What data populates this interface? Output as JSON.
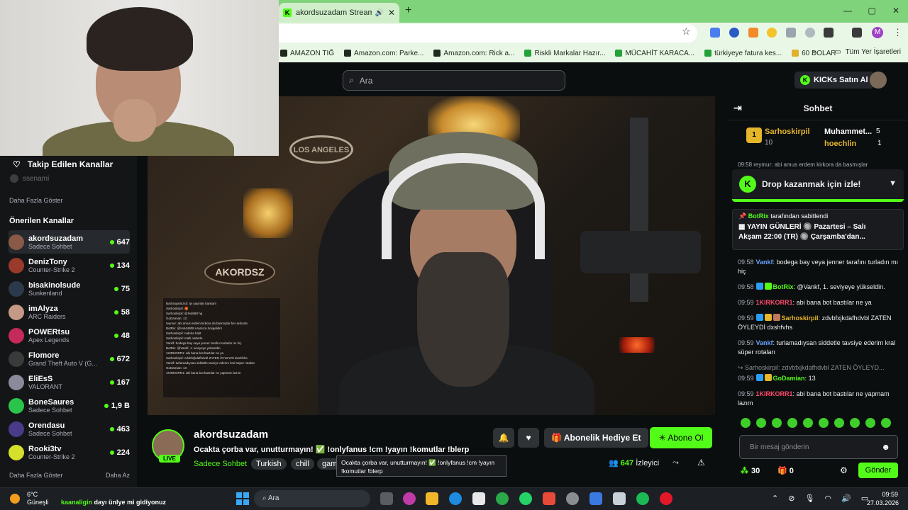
{
  "browser": {
    "tab_title": "akordsuzadam Stream - W...",
    "tab_close": "✕",
    "new_tab": "+",
    "window_controls": [
      "—",
      "▢",
      "✕"
    ],
    "profile_initial": "M",
    "bookmarks": [
      {
        "label": "AMAZON TIĞ",
        "color": "#1e2a1e"
      },
      {
        "label": "Amazon.com: Parke...",
        "color": "#1e2a1e"
      },
      {
        "label": "Amazon.com: Rick a...",
        "color": "#1e2a1e"
      },
      {
        "label": "Riskli Markalar Hazır...",
        "color": "#23a23a"
      },
      {
        "label": "MÜCAHİT KARACA...",
        "color": "#23a23a"
      },
      {
        "label": "türkiyeye fatura kes...",
        "color": "#23a23a"
      },
      {
        "label": "60 DOLAR",
        "color": "#e2b12c"
      }
    ],
    "bookmarks_overflow": "»",
    "all_bookmarks": "Tüm Yer İşaretleri"
  },
  "header": {
    "search_placeholder": "Ara",
    "kicks_button": "KICKs Satın Al"
  },
  "sidebar": {
    "followed_title": "Takip Edilen Kanallar",
    "followed_channel": "ssenami",
    "show_more": "Daha Fazla Göster",
    "suggested_title": "Önerilen Kanallar",
    "channels": [
      {
        "name": "akordsuzadam",
        "game": "Sadece Sohbet",
        "viewers": "647",
        "avatar": "#8a5a48"
      },
      {
        "name": "DenizTony",
        "game": "Counter-Strike 2",
        "viewers": "134",
        "avatar": "#9a3a2a"
      },
      {
        "name": "bisakinolsude",
        "game": "Sunkenland",
        "viewers": "75",
        "avatar": "#2a3a4a"
      },
      {
        "name": "imAlyza",
        "game": "ARC Raiders",
        "viewers": "58",
        "avatar": "#c49a86"
      },
      {
        "name": "POWERtsu",
        "game": "Apex Legends",
        "viewers": "48",
        "avatar": "#c42a5a"
      },
      {
        "name": "Flomore",
        "game": "Grand Theft Auto V (G...",
        "viewers": "672",
        "avatar": "#3a3a3a"
      },
      {
        "name": "EliEsS",
        "game": "VALORANT",
        "viewers": "167",
        "avatar": "#8a8a9a"
      },
      {
        "name": "BoneSaures",
        "game": "Sadece Sohbet",
        "viewers": "1,9 B",
        "avatar": "#2ac44a"
      },
      {
        "name": "Orendasu",
        "game": "Sadece Sohbet",
        "viewers": "463",
        "avatar": "#4a3a8a"
      },
      {
        "name": "Rooki3tv",
        "game": "Counter-Strike 2",
        "viewers": "224",
        "avatar": "#d4e02a"
      }
    ],
    "footer_more": "Daha Fazla Göster",
    "footer_less": "Daha Az"
  },
  "video": {
    "sign_top": "LOS ANGELES",
    "sign_lower": "AKORDSZ",
    "overlay_lines": [
      "lambrayamizx0: iyi yayınlar kankam",
      "Sarhoskirpil: 🎁",
      "Sarhoskirpil: @Hol668 hg",
      "GoDamian: 13",
      "reymur: abi amus erdem kirkora da basmışlar ber ardında",
      "BotRix: @Hol44808 Aramıza hosgeldin!",
      "Sarhoskirpil: nabırla halit",
      "Sarhoskirpil: malli neberle",
      "Vankf: bodega bay veya jenner tarafını turladın mı hiç",
      "BotRix: @Vankf, 1. seviyeye yükseldin.",
      "1KIRKORR1: abi bana bot bastılar ne ya",
      "Sarhoskirpil: zdvbfxjkdafhdvbl ZATEN ÖYLEYDİ dxshfvhs",
      "Vankf: turlamadıysan siddetle tavsiye ederim kral süper rotaları",
      "GoDamian: 13",
      "1KIRKORR1: abi bana bot bastılar ne yapmam lazım"
    ]
  },
  "stream": {
    "channel_name": "akordsuzadam",
    "live_badge": "LIVE",
    "title": "Ocakta çorba var, unutturmayın! ✅ !onlyfanus !cm !yayın  !komutlar !blerp",
    "category": "Sadece Sohbet",
    "tags": [
      "Turkish",
      "chill",
      "gam"
    ],
    "gift_button": "Abonelik Hediye Et",
    "subscribe_button": "Abone Ol",
    "viewer_count": "647",
    "viewer_label": "İzleyici",
    "tooltip": "Ocakta çorba var, unutturmayın! ✅ !onlyfanus !cm !yayın !komutlar !blerp"
  },
  "chat": {
    "title": "Sohbet",
    "leaderboard": [
      {
        "rank": "1",
        "name": "Sarhoskirpil",
        "value": "10",
        "color": "#e5b52a"
      },
      {
        "name": "Muhammet...",
        "value": "5",
        "color": "#ffffff"
      },
      {
        "name": "hoechlin",
        "value": "1",
        "color": "#e5b52a"
      }
    ],
    "scrolled_message": "09:58 reymur: abi amus erdem kirkora da basmışlar",
    "drop_banner": "Drop kazanmak için izle!",
    "pinned_by_name": "BotRix",
    "pinned_by_suffix": "tarafından sabitlendi",
    "pinned_text_1": "▦ YAYIN GÜNLERİ 🔘 Pazartesi – Salı",
    "pinned_text_2": "Akşam 22:00 (TR) 🔘 Çarşamba'dan...",
    "messages": [
      {
        "time": "09:58",
        "user": "Vankf",
        "color": "#66a3ff",
        "badges": [],
        "text": "bodega bay veya jenner tarafını turladın mı hiç"
      },
      {
        "time": "09:58",
        "user": "BotRix",
        "color": "#53fc18",
        "badges": [
          "#2a9df4",
          "#53fc18"
        ],
        "text": "@Vankf, 1. seviyeye yükseldin."
      },
      {
        "time": "09:59",
        "user": "1KIRKORR1",
        "color": "#ff4a6a",
        "badges": [],
        "text": "abi bana bot bastılar ne ya"
      },
      {
        "time": "09:59",
        "user": "Sarhoskirpil",
        "color": "#e5b52a",
        "badges": [
          "#2a9df4",
          "#e5b52a",
          "#c07a5a"
        ],
        "text": "zdvbfxjkdafhdvbl ZATEN ÖYLEYDİ dxshfvhs"
      },
      {
        "time": "09:59",
        "user": "Vankf",
        "color": "#66a3ff",
        "badges": [],
        "text": "turlamadıysan siddetle tavsiye ederim kral süper rotaları"
      },
      {
        "time": "09:59",
        "user": "GoDamian",
        "color": "#53fc18",
        "badges": [
          "#2a9df4",
          "#e5b52a"
        ],
        "text": "13",
        "reply": "↪ Sarhoskirpil: zdvbfxjkdafhdvbl ZATEN ÖYLEYD..."
      },
      {
        "time": "09:59",
        "user": "1KIRKORR1",
        "color": "#ff4a6a",
        "badges": [],
        "text": "abi bana bot bastılar ne yapmam lazım"
      }
    ],
    "input_placeholder": "Bir mesaj gönderin",
    "points": "30",
    "gifts": "0",
    "send_button": "Gönder"
  },
  "taskbar": {
    "temperature": "6°C",
    "weather": "Güneşli",
    "toast_user": "kaanaligin",
    "toast_text": "dayı ünlye mi gidiyonuz",
    "search": "Ara",
    "time": "09:59",
    "date": "27.03.2026"
  }
}
